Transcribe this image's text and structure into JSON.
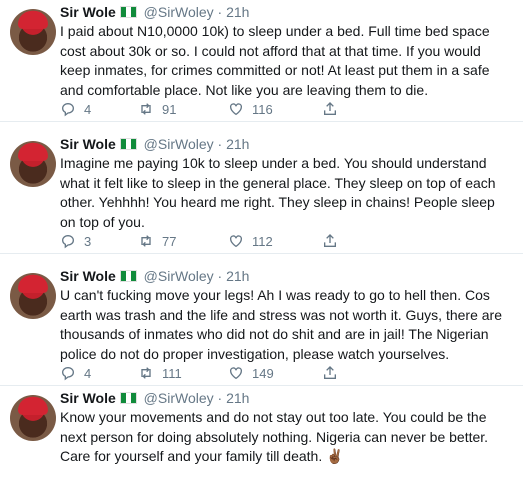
{
  "tweets": [
    {
      "name": "Sir Wole",
      "handle": "@SirWoley",
      "sep": "·",
      "time": "21h",
      "text": "I paid about N10,0000 10k) to sleep under a bed. Full time bed space cost about 30k or so. I could not afford that at that time. If you would keep inmates, for crimes committed or not! At least put them in a safe and comfortable place. Not like you are leaving them to die.",
      "replies": "4",
      "retweets": "91",
      "likes": "116"
    },
    {
      "name": "Sir Wole",
      "handle": "@SirWoley",
      "sep": "·",
      "time": "21h",
      "text": "Imagine me paying 10k to sleep under a bed. You should understand what it felt like to sleep in the general place. They sleep on top of each other. Yehhhh! You heard me right. They sleep in chains! People sleep on top of you.",
      "replies": "3",
      "retweets": "77",
      "likes": "112"
    },
    {
      "name": "Sir Wole",
      "handle": "@SirWoley",
      "sep": "·",
      "time": "21h",
      "text": "U can't fucking move your legs! Ah I was ready to go to hell then. Cos earth was trash and the life and stress was not worth it. Guys, there are thousands of inmates who did not do shit and are in jail! The Nigerian police do not do proper investigation, please watch yourselves.",
      "replies": "4",
      "retweets": "111",
      "likes": "149"
    },
    {
      "name": "Sir Wole",
      "handle": "@SirWoley",
      "sep": "·",
      "time": "21h",
      "text": "Know your movements and do not stay out too late. You could be the next person for doing absolutely nothing. Nigeria can never be better. Care for yourself and your family till death. ✌🏾"
    }
  ],
  "icons": {
    "avatar": "profile-photo",
    "flag": "nigeria-flag",
    "reply": "reply-icon",
    "retweet": "retweet-icon",
    "like": "heart-icon",
    "share": "share-icon"
  },
  "colors": {
    "text": "#14171a",
    "muted": "#657786",
    "divider": "#e6ecf0",
    "flag_green": "#118b3b"
  }
}
